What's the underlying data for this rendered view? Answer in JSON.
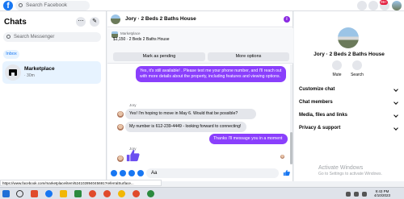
{
  "top_bar": {
    "search_placeholder": "Search Facebook",
    "notification_count": "99+"
  },
  "chats": {
    "title": "Chats",
    "search_placeholder": "Search Messenger",
    "tab": "Inbox",
    "conversation": {
      "name": "Marketplace",
      "time": "· 30m"
    }
  },
  "thread": {
    "title": "Jory · 2 Beds 2 Baths House",
    "listing": {
      "label": "Marketplace",
      "price_title": "$1,150 · 2 Beds 2 Baths House"
    },
    "mark_pending_label": "Mark as pending",
    "more_options_label": "More options",
    "messages": [
      {
        "from": "me",
        "text": "Yes, it's still available! . Please text me your phone number, and I'll reach out with more details about the property, including features and viewing options."
      },
      {
        "from": "them",
        "sender": "Jory",
        "text": "Yes! I'm hoping to move in May 6. Would that be possible?"
      },
      {
        "from": "them",
        "text": "My number is 612-239-4449 - looking forward to connecting!"
      },
      {
        "from": "me",
        "text": "Thanks I'll message you in a moment"
      },
      {
        "from": "them",
        "sender": "Jory",
        "text": ""
      }
    ],
    "composer_text": "Aa"
  },
  "details": {
    "name": "Jory · 2 Beds 2 Baths House",
    "mute_label": "Mute",
    "search_label": "Search",
    "sections": [
      "Customize chat",
      "Chat members",
      "Media, files and links",
      "Privacy & support"
    ]
  },
  "watermark": {
    "title": "Activate Windows",
    "subtitle": "Go to Settings to activate Windows."
  },
  "status_url": "https://www.facebook.com/marketplace/item/524102894045691?referralSurface...",
  "taskbar": {
    "time": "9:43 PM",
    "date": "4/10/2023"
  },
  "colors": {
    "brand": "#1877f2",
    "outgoing_bubble": "#8a3ffc"
  }
}
